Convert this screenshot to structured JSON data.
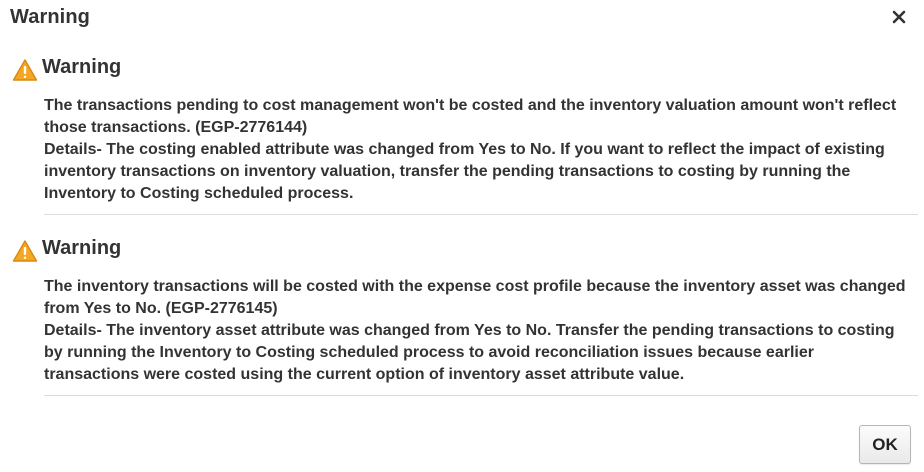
{
  "dialog": {
    "title": "Warning",
    "close_icon": "close-icon",
    "ok_label": "OK"
  },
  "messages": [
    {
      "icon": "warning-icon",
      "heading": "Warning",
      "text": "The transactions pending to cost management won't be costed and the inventory valuation amount won't reflect those transactions. (EGP-2776144)",
      "details": "Details- The costing enabled attribute was changed from Yes to No. If you want to reflect the impact of existing inventory transactions on inventory valuation, transfer the pending transactions to costing by running the Inventory to Costing scheduled process."
    },
    {
      "icon": "warning-icon",
      "heading": "Warning",
      "text": "The inventory transactions will be costed with the expense cost profile because the inventory asset was changed from Yes to No. (EGP-2776145)",
      "details": "Details- The inventory asset attribute was changed from Yes to No. Transfer the pending transactions to costing by running the Inventory to Costing scheduled process to avoid reconciliation issues because earlier transactions were costed using the current option of inventory asset attribute value."
    }
  ],
  "colors": {
    "warning_fill": "#f5a623",
    "warning_stroke": "#d98a0e",
    "text": "#333333",
    "divider": "#dcdcdc"
  }
}
